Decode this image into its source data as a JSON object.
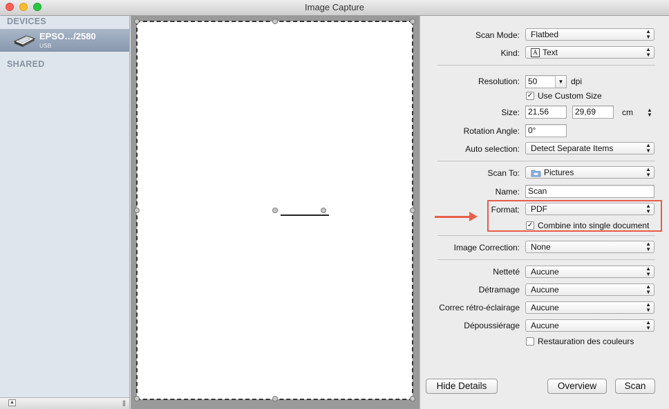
{
  "window": {
    "title": "Image Capture"
  },
  "sidebar": {
    "devices_header": "DEVICES",
    "device": {
      "name": "EPSO…/2580",
      "connection": "USB",
      "icon": "scanner-icon"
    },
    "shared_header": "SHARED"
  },
  "details": {
    "scan_mode": {
      "label": "Scan Mode:",
      "value": "Flatbed"
    },
    "kind": {
      "label": "Kind:",
      "value": "Text",
      "icon_glyph": "A"
    },
    "resolution": {
      "label": "Resolution:",
      "value": "50",
      "unit": "dpi"
    },
    "use_custom_size": {
      "label": "Use Custom Size",
      "checked": true
    },
    "size": {
      "label": "Size:",
      "width": "21,56",
      "height": "29,69",
      "unit": "cm"
    },
    "rotation": {
      "label": "Rotation Angle:",
      "value": "0°"
    },
    "auto_selection": {
      "label": "Auto selection:",
      "value": "Detect Separate Items"
    },
    "scan_to": {
      "label": "Scan To:",
      "value": "Pictures",
      "icon": "folder-icon"
    },
    "name": {
      "label": "Name:",
      "value": "Scan"
    },
    "format": {
      "label": "Format:",
      "value": "PDF"
    },
    "combine": {
      "label": "Combine into single document",
      "checked": true
    },
    "image_correction": {
      "label": "Image Correction:",
      "value": "None"
    },
    "nettete": {
      "label": "Netteté",
      "value": "Aucune"
    },
    "detramage": {
      "label": "Détramage",
      "value": "Aucune"
    },
    "correc": {
      "label": "Correc rétro-éclairage",
      "value": "Aucune"
    },
    "depoussierage": {
      "label": "Dépoussiérage",
      "value": "Aucune"
    },
    "restauration": {
      "label": "Restauration des couleurs",
      "checked": false
    }
  },
  "buttons": {
    "hide_details": "Hide Details",
    "overview": "Overview",
    "scan": "Scan"
  },
  "colors": {
    "highlight": "#e85a4a",
    "sidebar_selection": "#8fa0b6",
    "preview_bg": "#9a9a9a"
  }
}
